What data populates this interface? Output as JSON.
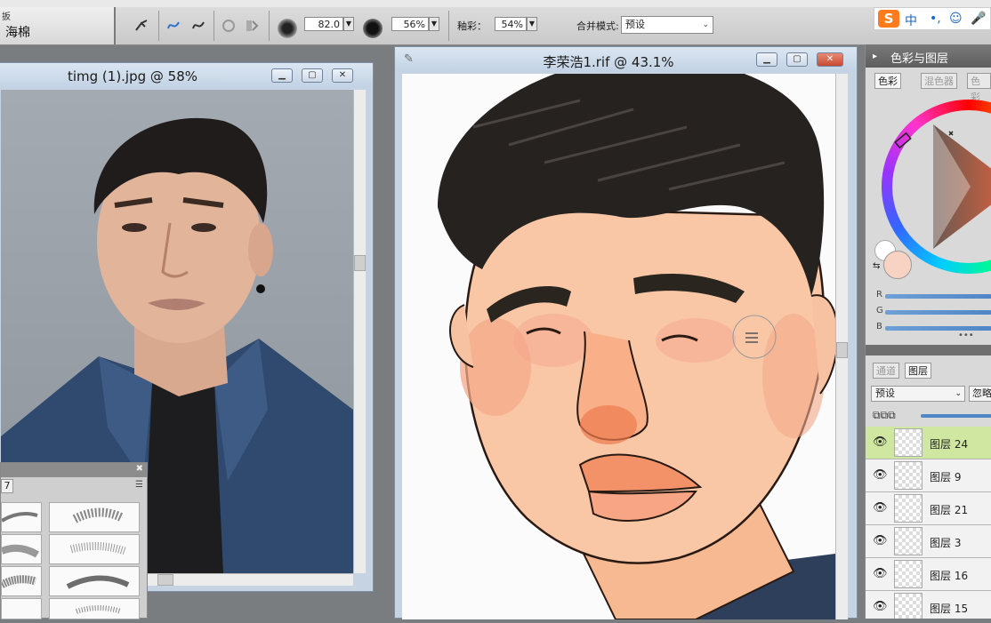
{
  "toolbar": {
    "tool_category": "扳",
    "tool_name": "海棉",
    "brush_size": "82.0",
    "opacity": "56%",
    "color_blend_label": "釉彩：",
    "color_blend_value": "54%",
    "blend_mode_label": "合并模式:",
    "blend_mode_value": "预设"
  },
  "ime": {
    "logo": "S",
    "lang": "中",
    "punct": "•,",
    "emoji": "☺",
    "mic": "🎤"
  },
  "reference_window": {
    "title": "timg (1).jpg @ 58%"
  },
  "canvas_window": {
    "title": "李荣浩1.rif @ 43.1%"
  },
  "brush_palette": {
    "tab_label": "7"
  },
  "color_panel": {
    "header": "色彩与图层",
    "tabs": [
      "色彩",
      "混色器",
      "色彩"
    ],
    "channels": [
      "R",
      "G",
      "B"
    ],
    "main_color": "#f8d2c3",
    "secondary_color": "#ffffff"
  },
  "layers_panel": {
    "tabs": [
      "通道",
      "图层"
    ],
    "composite_mode": "预设",
    "composite_extra": "忽略",
    "layers": [
      {
        "name": "图层 24",
        "selected": true
      },
      {
        "name": "图层 9",
        "selected": false
      },
      {
        "name": "图层 21",
        "selected": false
      },
      {
        "name": "图层 3",
        "selected": false
      },
      {
        "name": "图层 16",
        "selected": false
      },
      {
        "name": "图层 15",
        "selected": false
      }
    ]
  }
}
